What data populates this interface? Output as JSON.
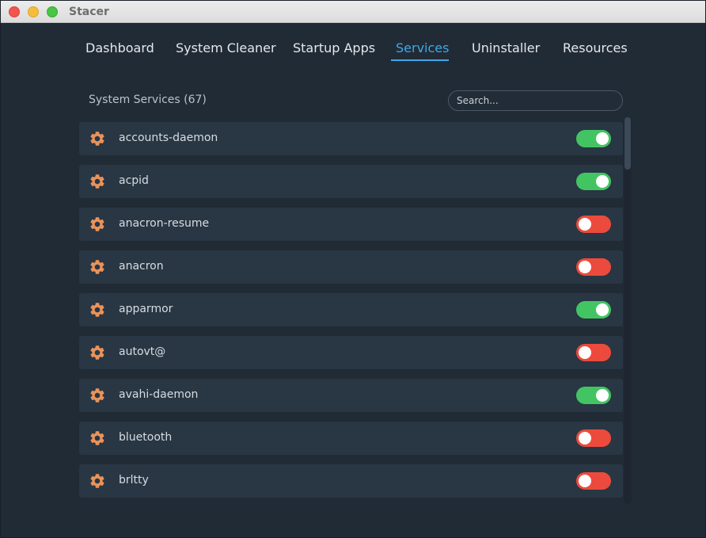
{
  "window": {
    "title": "Stacer"
  },
  "tabs": [
    {
      "label": "Dashboard"
    },
    {
      "label": "System Cleaner"
    },
    {
      "label": "Startup Apps"
    },
    {
      "label": "Services",
      "active": true
    },
    {
      "label": "Uninstaller"
    },
    {
      "label": "Resources"
    }
  ],
  "services": {
    "header": "System Services (67)",
    "search_placeholder": "Search...",
    "icon": "gear-icon",
    "colors": {
      "on": "#43c463",
      "off": "#ec4a3c",
      "icon": "#e9935a",
      "accent": "#3fa8e8"
    },
    "items": [
      {
        "name": "accounts-daemon",
        "enabled": true
      },
      {
        "name": "acpid",
        "enabled": true
      },
      {
        "name": "anacron-resume",
        "enabled": false
      },
      {
        "name": "anacron",
        "enabled": false
      },
      {
        "name": "apparmor",
        "enabled": true
      },
      {
        "name": "autovt@",
        "enabled": false
      },
      {
        "name": "avahi-daemon",
        "enabled": true
      },
      {
        "name": "bluetooth",
        "enabled": false
      },
      {
        "name": "brltty",
        "enabled": false
      }
    ]
  }
}
